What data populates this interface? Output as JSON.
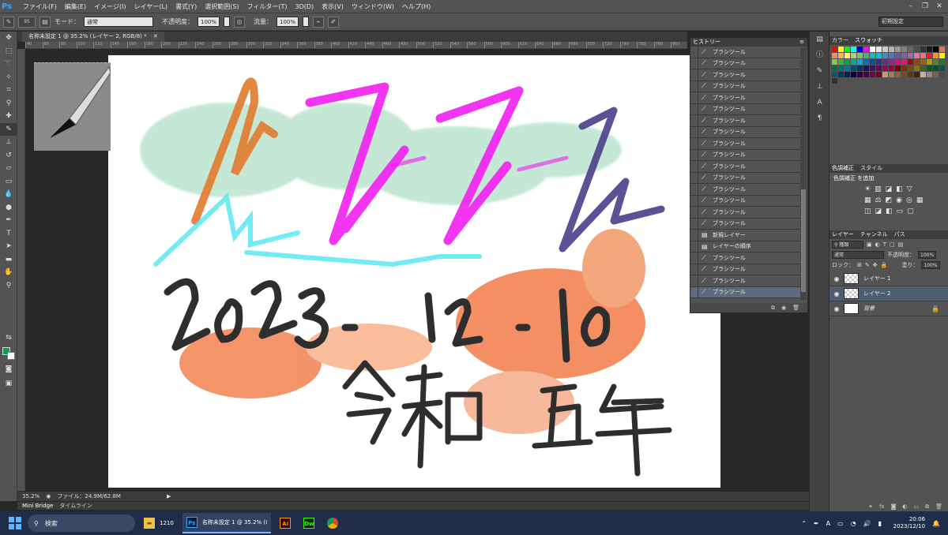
{
  "app": {
    "logo": "Ps"
  },
  "menu": [
    "ファイル(F)",
    "編集(E)",
    "イメージ(I)",
    "レイヤー(L)",
    "書式(Y)",
    "選択範囲(S)",
    "フィルター(T)",
    "3D(D)",
    "表示(V)",
    "ウィンドウ(W)",
    "ヘルプ(H)"
  ],
  "options": {
    "brush_size": "95",
    "mode_label": "モード：",
    "mode_value": "通常",
    "opacity_label": "不透明度：",
    "opacity_value": "100%",
    "flow_label": "流量：",
    "flow_value": "100%"
  },
  "workspace": "初期設定",
  "document": {
    "tab_title": "名称未設定 1 @ 35.2% (レイヤー 2, RGB/8) *",
    "zoom": "35.2%",
    "file_info": "ファイル：24.9M/62.8M"
  },
  "ruler_ticks": [
    "40",
    "60",
    "80",
    "100",
    "120",
    "140",
    "160",
    "180",
    "200",
    "220",
    "240",
    "260",
    "280",
    "300",
    "320",
    "340",
    "360",
    "380",
    "400",
    "420",
    "440",
    "460",
    "480",
    "500",
    "520",
    "540",
    "560",
    "580",
    "600",
    "620",
    "640",
    "660",
    "680",
    "700",
    "720",
    "740",
    "760",
    "780",
    "800"
  ],
  "bottom_tabs": [
    "Mini Bridge",
    "タイムライン"
  ],
  "colors": {
    "foreground": "#0b9d4b",
    "background": "#ffffff",
    "accent": "#31a8ff"
  },
  "history": {
    "title": "ヒストリー",
    "items": [
      {
        "label": "ブラシツール",
        "icon": "brush-icon"
      },
      {
        "label": "ブラシツール",
        "icon": "brush-icon"
      },
      {
        "label": "ブラシツール",
        "icon": "brush-icon"
      },
      {
        "label": "ブラシツール",
        "icon": "brush-icon"
      },
      {
        "label": "ブラシツール",
        "icon": "brush-icon"
      },
      {
        "label": "ブラシツール",
        "icon": "brush-icon"
      },
      {
        "label": "ブラシツール",
        "icon": "brush-icon"
      },
      {
        "label": "ブラシツール",
        "icon": "brush-icon"
      },
      {
        "label": "ブラシツール",
        "icon": "brush-icon"
      },
      {
        "label": "ブラシツール",
        "icon": "brush-icon"
      },
      {
        "label": "ブラシツール",
        "icon": "brush-icon"
      },
      {
        "label": "ブラシツール",
        "icon": "brush-icon"
      },
      {
        "label": "ブラシツール",
        "icon": "brush-icon"
      },
      {
        "label": "ブラシツール",
        "icon": "brush-icon"
      },
      {
        "label": "ブラシツール",
        "icon": "brush-icon"
      },
      {
        "label": "ブラシツール",
        "icon": "brush-icon"
      },
      {
        "label": "新規レイヤー",
        "icon": "layer-icon"
      },
      {
        "label": "レイヤーの順序",
        "icon": "layer-icon"
      },
      {
        "label": "ブラシツール",
        "icon": "brush-icon"
      },
      {
        "label": "ブラシツール",
        "icon": "brush-icon"
      },
      {
        "label": "ブラシツール",
        "icon": "brush-icon"
      },
      {
        "label": "ブラシツール",
        "icon": "brush-icon"
      }
    ]
  },
  "swatches_panel": {
    "tabs": [
      "カラー",
      "スウォッチ"
    ]
  },
  "adjustments": {
    "tabs": [
      "色調補正",
      "スタイル"
    ],
    "title": "色調補正 を追加"
  },
  "layers": {
    "tabs": [
      "レイヤー",
      "チャンネル",
      "パス"
    ],
    "filter": "種類",
    "blend_mode": "通常",
    "opacity_label": "不透明度：",
    "opacity": "100%",
    "lock_label": "ロック：",
    "fill_label": "塗り：",
    "fill": "100%",
    "items": [
      {
        "name": "レイヤー 1"
      },
      {
        "name": "レイヤー 2"
      },
      {
        "name": "背景"
      }
    ]
  },
  "taskbar": {
    "search_placeholder": "検索",
    "folder_label": "1210",
    "ps_window_label": "名称未設定 1 @ 35.2% (I",
    "time": "20:06",
    "date": "2023/12/10",
    "ime": "A"
  }
}
